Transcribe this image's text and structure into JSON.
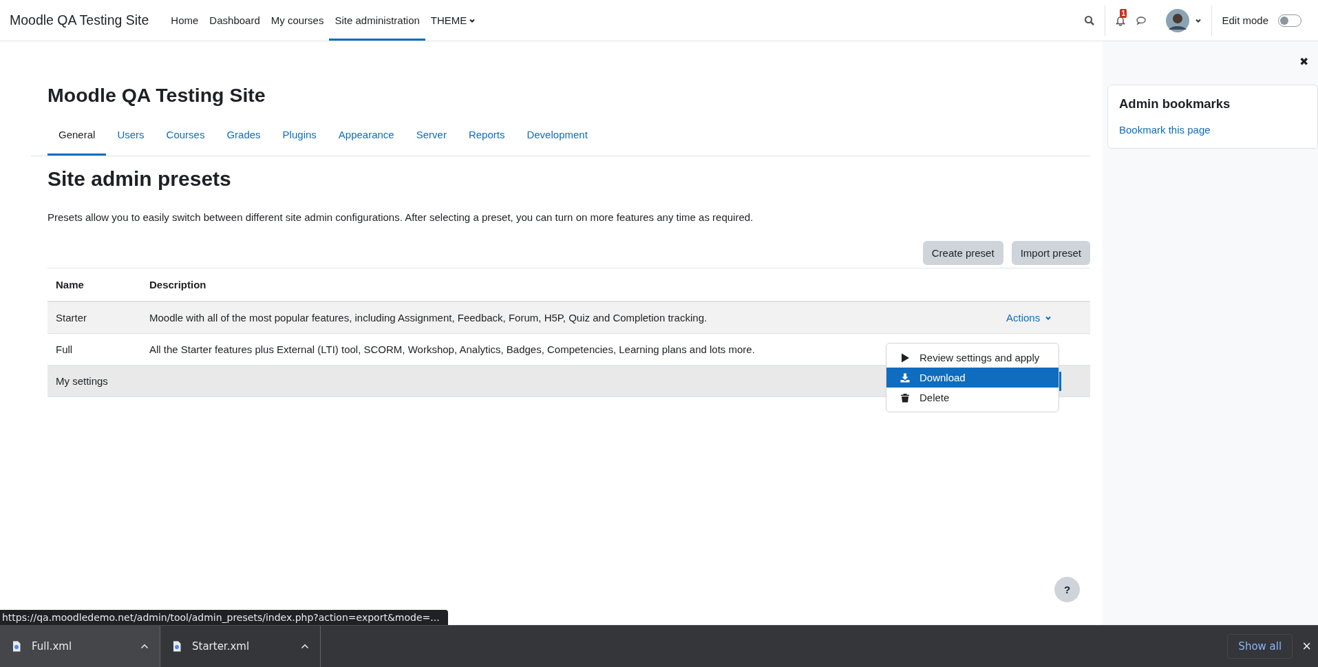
{
  "navbar": {
    "brand": "Moodle QA Testing Site",
    "items": [
      {
        "label": "Home",
        "selected": false,
        "dropdown": false
      },
      {
        "label": "Dashboard",
        "selected": false,
        "dropdown": false
      },
      {
        "label": "My courses",
        "selected": false,
        "dropdown": false
      },
      {
        "label": "Site administration",
        "selected": true,
        "dropdown": false
      },
      {
        "label": "THEME",
        "selected": false,
        "dropdown": true
      }
    ],
    "notification_count": "1",
    "edit_mode": {
      "label": "Edit mode",
      "on": false
    }
  },
  "page_title": "Moodle QA Testing Site",
  "tabs": [
    {
      "label": "General",
      "selected": true
    },
    {
      "label": "Users",
      "selected": false
    },
    {
      "label": "Courses",
      "selected": false
    },
    {
      "label": "Grades",
      "selected": false
    },
    {
      "label": "Plugins",
      "selected": false
    },
    {
      "label": "Appearance",
      "selected": false
    },
    {
      "label": "Server",
      "selected": false
    },
    {
      "label": "Reports",
      "selected": false
    },
    {
      "label": "Development",
      "selected": false
    }
  ],
  "heading": "Site admin presets",
  "intro": "Presets allow you to easily switch between different site admin configurations. After selecting a preset, you can turn on more features any time as required.",
  "buttons": [
    "Create preset",
    "Import preset"
  ],
  "table": {
    "columns": [
      "Name",
      "Description"
    ],
    "rows": [
      {
        "name": "Starter",
        "description": "Moodle with all of the most popular features, including Assignment, Feedback, Forum, H5P, Quiz and Completion tracking.",
        "hovered": true,
        "selected": false,
        "actions": "Actions"
      },
      {
        "name": "Full",
        "description": "All the Starter features plus External (LTI) tool, SCORM, Workshop, Analytics, Badges, Competencies, Learning plans and lots more.",
        "hovered": false,
        "selected": false
      },
      {
        "name": "My settings",
        "description": "",
        "hovered": false,
        "selected": true
      }
    ]
  },
  "actions_menu": [
    {
      "kind": "play",
      "label": "Review settings and apply",
      "selected": false
    },
    {
      "kind": "download",
      "label": "Download",
      "selected": true
    },
    {
      "kind": "trash",
      "label": "Delete",
      "selected": false
    }
  ],
  "help_button": "?",
  "drawer": {
    "close": "✖",
    "title": "Admin bookmarks",
    "link": "Bookmark this page"
  },
  "status_url": "https://qa.moodledemo.net/admin/tool/admin_presets/index.php?action=export&mode=...",
  "downloads": [
    {
      "name": "Full.xml",
      "selected": true
    },
    {
      "name": "Starter.xml",
      "selected": false
    }
  ],
  "download_bar": {
    "show_all": "Show all",
    "close": "×"
  }
}
